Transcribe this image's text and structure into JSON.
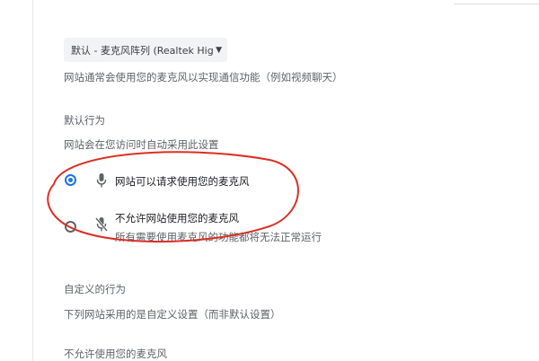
{
  "microphone_select": {
    "value": "默认 - 麦克风阵列 (Realtek High Definition Audio)"
  },
  "description": "网站通常会使用您的麦克风以实现通信功能（例如视频聊天）",
  "default_behavior": {
    "heading": "默认行为",
    "subtitle": "网站会在您访问时自动采用此设置",
    "options": [
      {
        "label": "网站可以请求使用您的麦克风",
        "selected": true,
        "icon": "mic-icon"
      },
      {
        "label": "不允许网站使用您的麦克风",
        "sublabel": "所有需要使用麦克风的功能都将无法正常运行",
        "selected": false,
        "icon": "mic-off-icon"
      }
    ]
  },
  "custom_behavior": {
    "heading": "自定义的行为",
    "subtitle": "下列网站采用的是自定义设置（而非默认设置）"
  },
  "blocked_section": {
    "heading": "不允许使用您的麦克风"
  },
  "colors": {
    "accent": "#1a73e8",
    "annotation": "#d93025"
  }
}
